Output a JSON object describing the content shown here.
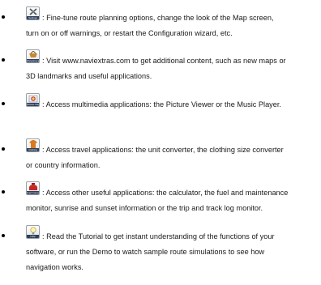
{
  "items": [
    {
      "icon": "settings-icon",
      "icon_caption": "Settings",
      "line1": ": Fine-tune route planning options, change the look of the Map screen,",
      "line2": "turn on or off warnings, or restart the Configuration wizard, etc.",
      "line3": ""
    },
    {
      "icon": "naviextras-icon",
      "icon_caption": "Shopping and Extras",
      "line1": ": Visit www.naviextras.com to get additional content, such as new maps or",
      "line2": "3D landmarks and useful applications.",
      "line3": ""
    },
    {
      "icon": "picture-viewer-icon",
      "icon_caption": "Picture Viewer",
      "line1": ": Access multimedia applications: the Picture Viewer or the Music Player.",
      "line2": "",
      "line3": ""
    },
    {
      "icon": "clothing-icon",
      "icon_caption": "Clothing",
      "line1": ": Access travel applications: the unit converter, the clothing size converter",
      "line2": "or country information.",
      "line3": ""
    },
    {
      "icon": "fuel-consumption-icon",
      "icon_caption": "Fuel Consumption",
      "line1": ": Access other useful applications: the calculator, the fuel and maintenance",
      "line2": "monitor, sunrise and sunset information or the trip and track log monitor.",
      "line3": ""
    },
    {
      "icon": "help-icon",
      "icon_caption": "Help",
      "line1": ": Read the Tutorial to get instant understanding of the functions of your",
      "line2": "software, or run the Demo to watch sample route simulations to see how",
      "line3": "navigation works."
    }
  ]
}
